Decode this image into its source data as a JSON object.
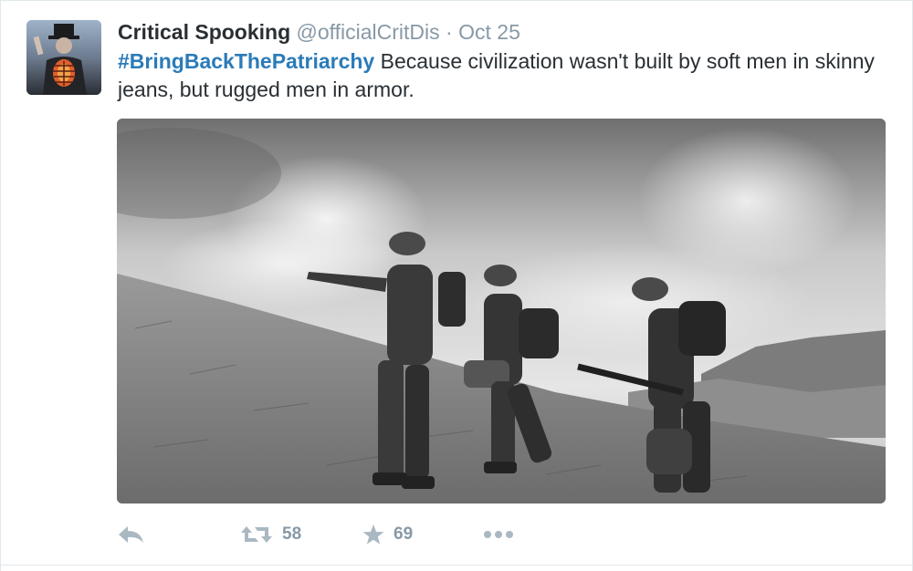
{
  "tweet": {
    "fullname": "Critical Spooking",
    "username": "@officialCritDis",
    "separator": "·",
    "timestamp": "Oct 25",
    "hashtag": "#BringBackThePatriarchy",
    "body": " Because civilization wasn't built by soft men in skinny jeans, but rugged men in armor."
  },
  "actions": {
    "retweet_count": "58",
    "favorite_count": "69"
  },
  "icons": {
    "reply": "reply-icon",
    "retweet": "retweet-icon",
    "favorite": "star-icon",
    "more": "more-icon"
  },
  "colors": {
    "link": "#2b7bb9",
    "text": "#292f33",
    "muted": "#8899a6",
    "icon": "#aab8c2"
  }
}
